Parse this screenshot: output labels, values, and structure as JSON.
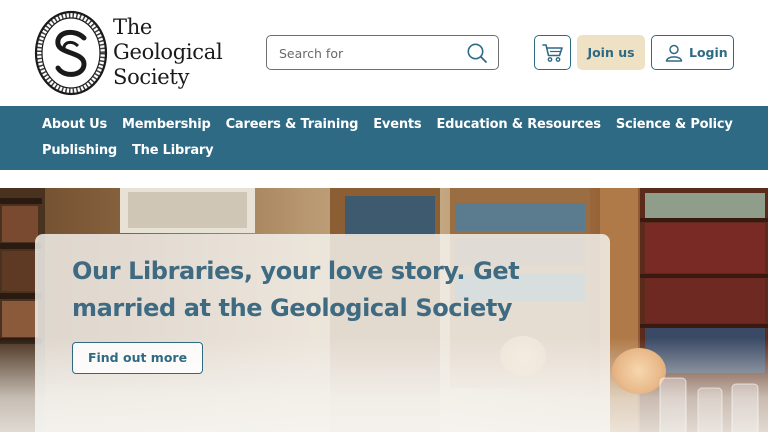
{
  "header": {
    "logo_line1": "The",
    "logo_line2": "Geological",
    "logo_line3": "Society",
    "seal_initials": "GS",
    "search_placeholder": "Search for",
    "join_label": "Join us",
    "login_label": "Login"
  },
  "nav": {
    "row1": [
      "About Us",
      "Membership",
      "Careers & Training",
      "Events",
      "Education & Resources",
      "Science & Policy"
    ],
    "row2": [
      "Publishing",
      "The Library"
    ]
  },
  "hero": {
    "title": "Our Libraries, your love story. Get married at the Geological Society",
    "cta_label": "Find out more"
  },
  "colors": {
    "brand_teal": "#2f6a84",
    "join_bg": "#efe2c4",
    "title_color": "#3e6a82"
  },
  "icons": [
    "search-icon",
    "cart-icon",
    "user-icon"
  ]
}
